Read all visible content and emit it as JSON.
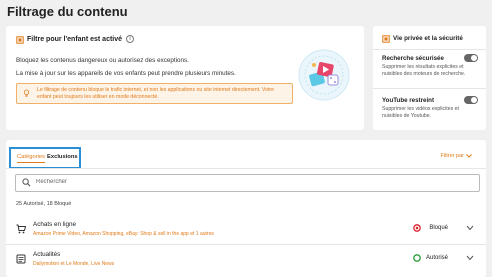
{
  "page": {
    "title": "Filtrage du contenu"
  },
  "main_card": {
    "header": "Filtre pour l'enfant est activé",
    "info_icon": "info-icon",
    "paragraph1": "Bloquez les contenus dangereux ou autorisez des exceptions.",
    "paragraph2": "La mise à jour sur les appareils de vos enfants peut prendre plusieurs minutes.",
    "warning": "Le filtrage de contenu bloque le trafic internet, et non les applications ou site internet directement. Votre enfant peut toujours les utiliser en mode déconnecté."
  },
  "side_card": {
    "header": "Vie privée et la sécurité",
    "settings": [
      {
        "name": "Recherche sécurisée",
        "desc": "Supprimer les résultats explicites et nuisibles des moteurs de recherche."
      },
      {
        "name": "YouTube restreint",
        "desc": "Supprimer les vidéos explicites et nuisibles de Youtube."
      }
    ]
  },
  "list": {
    "tabs": [
      "Catégories",
      "Exclusions"
    ],
    "filter_by": "Filtrer par",
    "search_placeholder": "Rechercher",
    "counts": "25 Autorisé, 18 Bloqué",
    "rows": [
      {
        "name": "Achats en ligne",
        "sub": "Amazon Prime Video, Amazon Shopping, eBay: Shop & sell in the app et 1 autres",
        "status": "Bloqué"
      },
      {
        "name": "Actualités",
        "sub": "Dailymotion et Le Monde, Live News",
        "status": "Autorisé"
      }
    ]
  },
  "colors": {
    "accent": "#e07b1a",
    "blocked": "#d9232e",
    "allowed": "#2a9d3a",
    "tab_focus": "#2b8fd6"
  }
}
